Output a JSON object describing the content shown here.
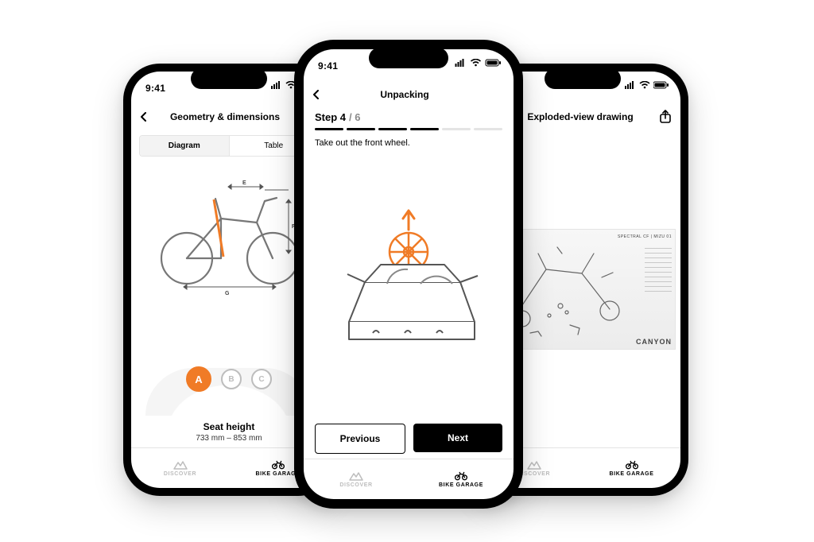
{
  "status": {
    "time": "9:41"
  },
  "colors": {
    "accent": "#f07b26"
  },
  "tabs": {
    "discover": "DISCOVER",
    "garage": "BIKE GARAGE"
  },
  "left": {
    "title": "Geometry & dimensions",
    "seg_diagram": "Diagram",
    "seg_table": "Table",
    "dots": {
      "a": "A",
      "b": "B",
      "c": "C"
    },
    "label": "Seat height",
    "value": "733 mm – 853 mm"
  },
  "center": {
    "title": "Unpacking",
    "step_label": "Step 4",
    "step_total": "/ 6",
    "progress_done": 4,
    "progress_total": 6,
    "instruction": "Take out the front wheel.",
    "prev": "Previous",
    "next": "Next"
  },
  "right": {
    "title": "Exploded-view drawing",
    "model": "SPECTRAL CF | MIZU 01",
    "brand": "CANYON"
  }
}
